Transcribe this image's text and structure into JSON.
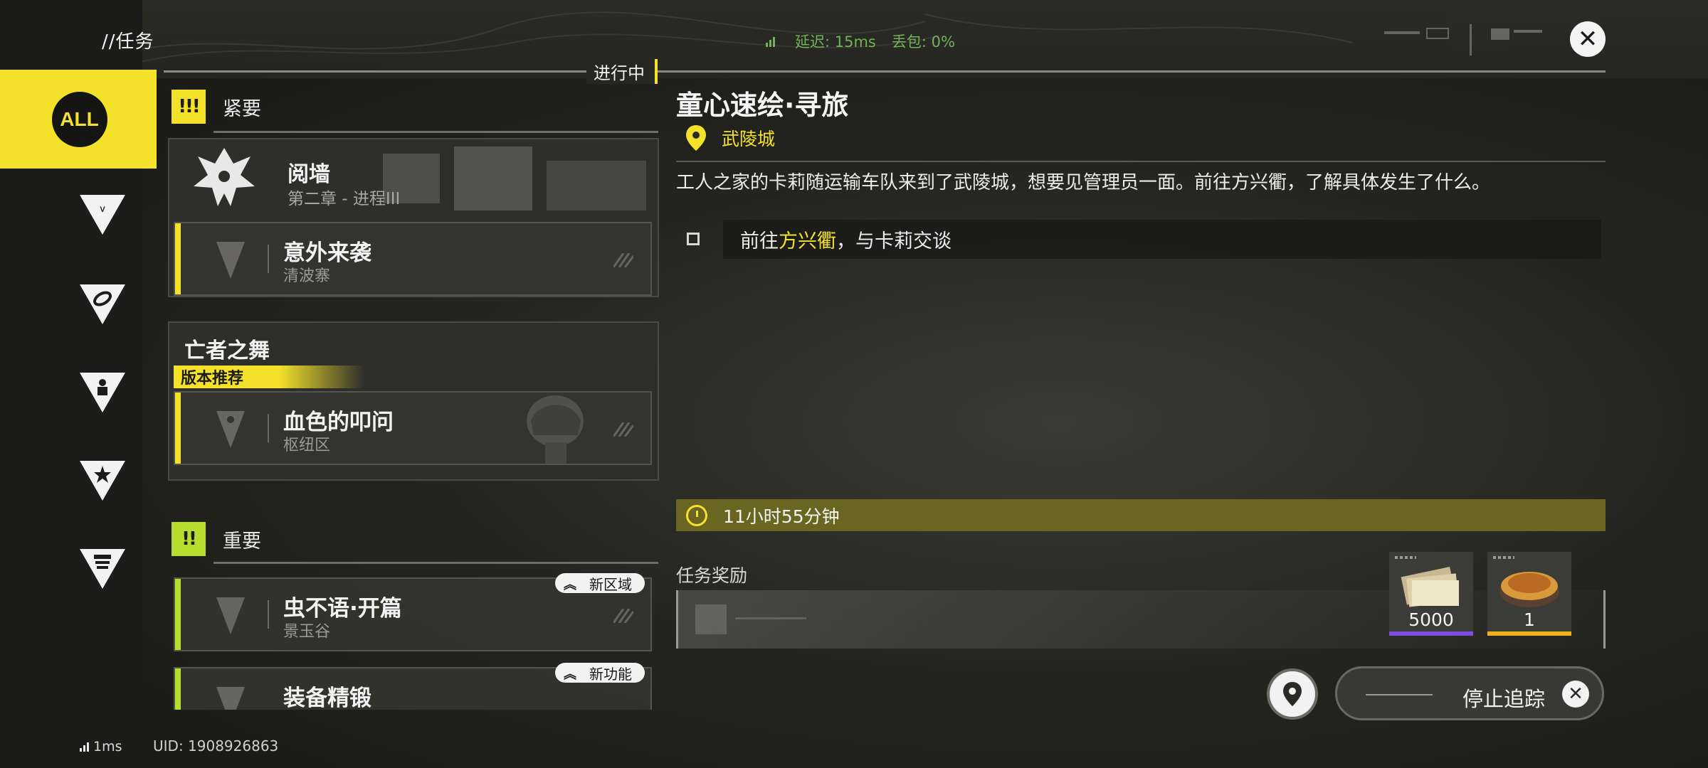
{
  "header": {
    "page_title": "//任务",
    "latency_label": "延迟: 15ms",
    "packet_loss_label": "丢包: 0%",
    "close_icon": "close-icon"
  },
  "sidebar": {
    "filters": [
      {
        "label": "ALL",
        "icon": "all-filter-icon",
        "active": true
      },
      {
        "label": "",
        "icon": "endfield-filter-icon",
        "active": false
      },
      {
        "label": "",
        "icon": "swirl-filter-icon",
        "active": false
      },
      {
        "label": "",
        "icon": "person-filter-icon",
        "active": false
      },
      {
        "label": "",
        "icon": "star-filter-icon",
        "active": false
      },
      {
        "label": "",
        "icon": "building-filter-icon",
        "active": false
      }
    ]
  },
  "quest_list": {
    "status_tag": "进行中",
    "urgent": {
      "badge": "!!!",
      "label": "紧要",
      "banner_title": "阅墙",
      "banner_sub": "第二章 - 进程III",
      "quest1_title": "意外来袭",
      "quest1_sub": "清波寨"
    },
    "dance": {
      "group_title": "亡者之舞",
      "version_tag": "版本推荐",
      "quest_title": "血色的叩问",
      "quest_sub": "枢纽区"
    },
    "important": {
      "badge": "!!",
      "label": "重要",
      "quest1_title": "虫不语·开篇",
      "quest1_sub": "景玉谷",
      "quest1_tag": "新区域",
      "quest2_title": "装备精锻",
      "quest2_tag": "新功能"
    }
  },
  "detail": {
    "title": "童心速绘·寻旅",
    "location": "武陵城",
    "description": "工人之家的卡莉随运输车队来到了武陵城，想要见管理员一面。前往方兴衢，了解具体发生了什么。",
    "objective_prefix": "前往",
    "objective_highlight": "方兴衢",
    "objective_suffix": "，与卡莉交谈",
    "timer": "11小时55分钟",
    "reward_label": "任务奖励",
    "rewards": [
      {
        "name": "currency-notes",
        "qty": "5000",
        "rarity_color": "#7b4de0"
      },
      {
        "name": "pie-food",
        "qty": "1",
        "rarity_color": "#f0b020"
      }
    ],
    "stop_tracking": "停止追踪"
  },
  "footer": {
    "ping": "1ms",
    "uid": "UID: 1908926863"
  },
  "colors": {
    "accent": "#f4e22a",
    "important": "#b6de2f",
    "net_ok": "#72b35a"
  }
}
